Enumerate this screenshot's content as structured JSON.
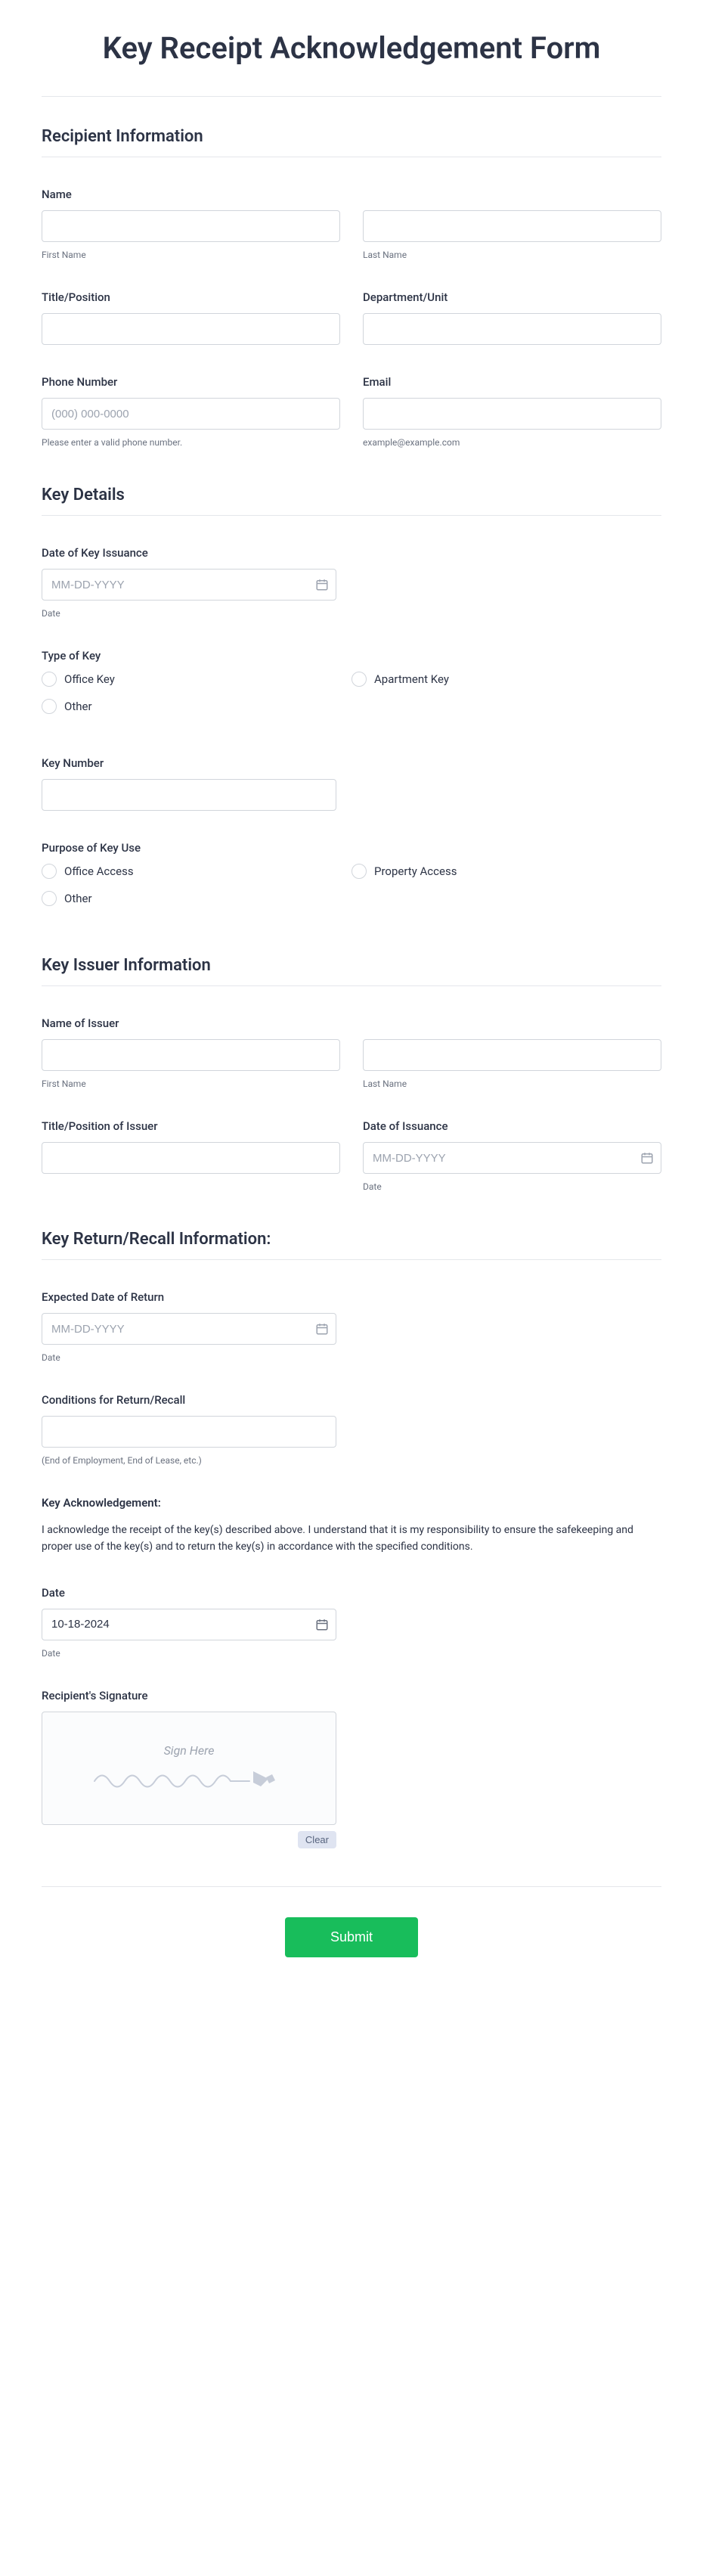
{
  "title": "Key Receipt Acknowledgement Form",
  "sections": {
    "recipient": {
      "heading": "Recipient Information"
    },
    "keyDetails": {
      "heading": "Key Details"
    },
    "issuer": {
      "heading": "Key Issuer Information"
    },
    "return": {
      "heading": "Key Return/Recall Information:"
    }
  },
  "labels": {
    "name": "Name",
    "firstName": "First Name",
    "lastName": "Last Name",
    "titlePosition": "Title/Position",
    "departmentUnit": "Department/Unit",
    "phoneNumber": "Phone Number",
    "phonePlaceholder": "(000) 000-0000",
    "phoneHint": "Please enter a valid phone number.",
    "email": "Email",
    "emailHint": "example@example.com",
    "dateOfKeyIssuance": "Date of Key Issuance",
    "datePlaceholder": "MM-DD-YYYY",
    "dateSub": "Date",
    "typeOfKey": "Type of Key",
    "keyNumber": "Key Number",
    "purposeOfKeyUse": "Purpose of Key Use",
    "nameOfIssuer": "Name of Issuer",
    "titlePositionIssuer": "Title/Position of Issuer",
    "dateOfIssuance": "Date of Issuance",
    "expectedReturn": "Expected Date of Return",
    "conditionsReturn": "Conditions for Return/Recall",
    "conditionsHint": "(End of Employment, End of Lease, etc.)",
    "ackHeading": "Key Acknowledgement:",
    "ackText": "I acknowledge the receipt of the key(s) described above. I understand that it is my responsibility to ensure the safekeeping and proper use of the key(s) and to return the key(s) in accordance with the specified conditions.",
    "dateLabel": "Date",
    "dateValue": "10-18-2024",
    "recipientSignature": "Recipient's Signature",
    "signHere": "Sign Here",
    "clear": "Clear",
    "submit": "Submit"
  },
  "options": {
    "typeOfKey": [
      "Office Key",
      "Apartment Key",
      "Other"
    ],
    "purpose": [
      "Office Access",
      "Property Access",
      "Other"
    ]
  }
}
